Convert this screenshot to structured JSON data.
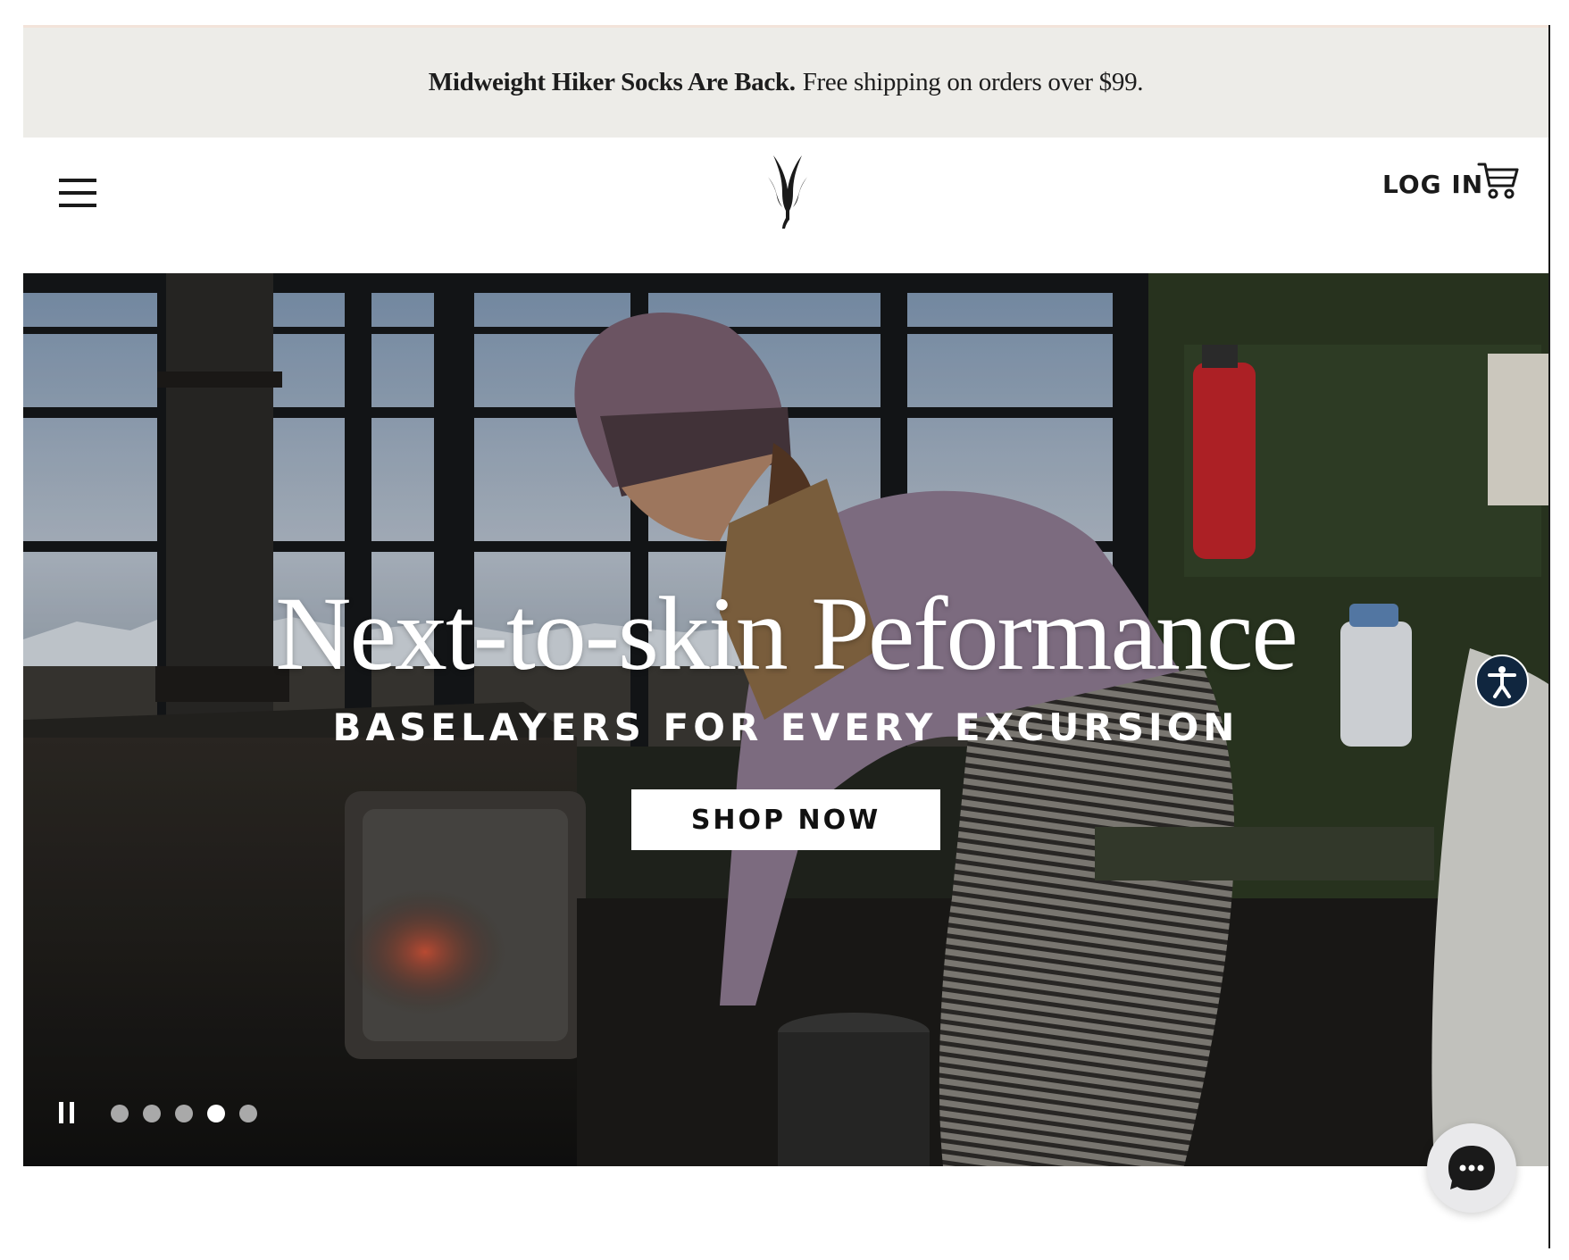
{
  "announcement": {
    "bold_text": "Midweight Hiker Socks Are Back.",
    "text": "Free shipping on orders over $99."
  },
  "header": {
    "login_label": "LOG IN"
  },
  "hero": {
    "title": "Next-to-skin Peformance",
    "subtitle": "BASELAYERS FOR EVERY EXCURSION",
    "cta_label": "SHOP NOW",
    "slides": [
      {
        "active": false
      },
      {
        "active": false
      },
      {
        "active": false
      },
      {
        "active": true
      },
      {
        "active": false
      }
    ]
  },
  "icons": {
    "menu": "hamburger-menu-icon",
    "logo": "brand-logo",
    "cart": "cart-icon",
    "pause": "pause-icon",
    "accessibility": "accessibility-icon",
    "chat": "chat-icon"
  },
  "colors": {
    "announcement_bg": "#edece8",
    "text_dark": "#1a1a1a",
    "accessibility_bg": "#10263f",
    "chat_bg": "#e9e9eb"
  }
}
